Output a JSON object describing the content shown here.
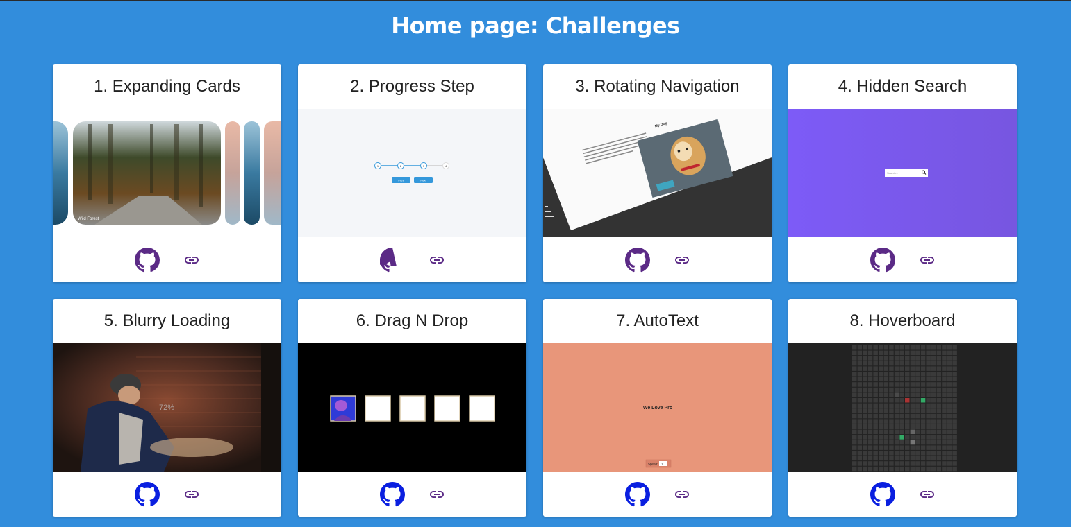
{
  "page": {
    "title": "Home page: Challenges"
  },
  "cards": [
    {
      "title": "1. Expanding Cards",
      "preview": "expanding-cards",
      "preview_caption": "Wild Forest"
    },
    {
      "title": "2. Progress Step",
      "preview": "progress-step",
      "steps": [
        "1",
        "2",
        "3",
        "4"
      ],
      "buttons": [
        "Prev",
        "Next"
      ]
    },
    {
      "title": "3. Rotating Navigation",
      "preview": "rotating-navigation",
      "heading": "My Dog"
    },
    {
      "title": "4. Hidden Search",
      "preview": "hidden-search",
      "placeholder": "Search..."
    },
    {
      "title": "5. Blurry Loading",
      "preview": "blurry-loading",
      "loading_text": "72%"
    },
    {
      "title": "6. Drag N Drop",
      "preview": "drag-n-drop",
      "empty_slots": 4
    },
    {
      "title": "7. AutoText",
      "preview": "autotext",
      "text": "We Love Pro",
      "speed_label": "Speed:",
      "speed_value": "1"
    },
    {
      "title": "8. Hoverboard",
      "preview": "hoverboard"
    }
  ],
  "icons": {
    "repo": "github-icon",
    "live": "link-icon"
  },
  "colors": {
    "background": "#328ddc",
    "card": "#ffffff",
    "icon_visited": "#5b2a86",
    "icon_unvisited": "#0a1fe0"
  }
}
